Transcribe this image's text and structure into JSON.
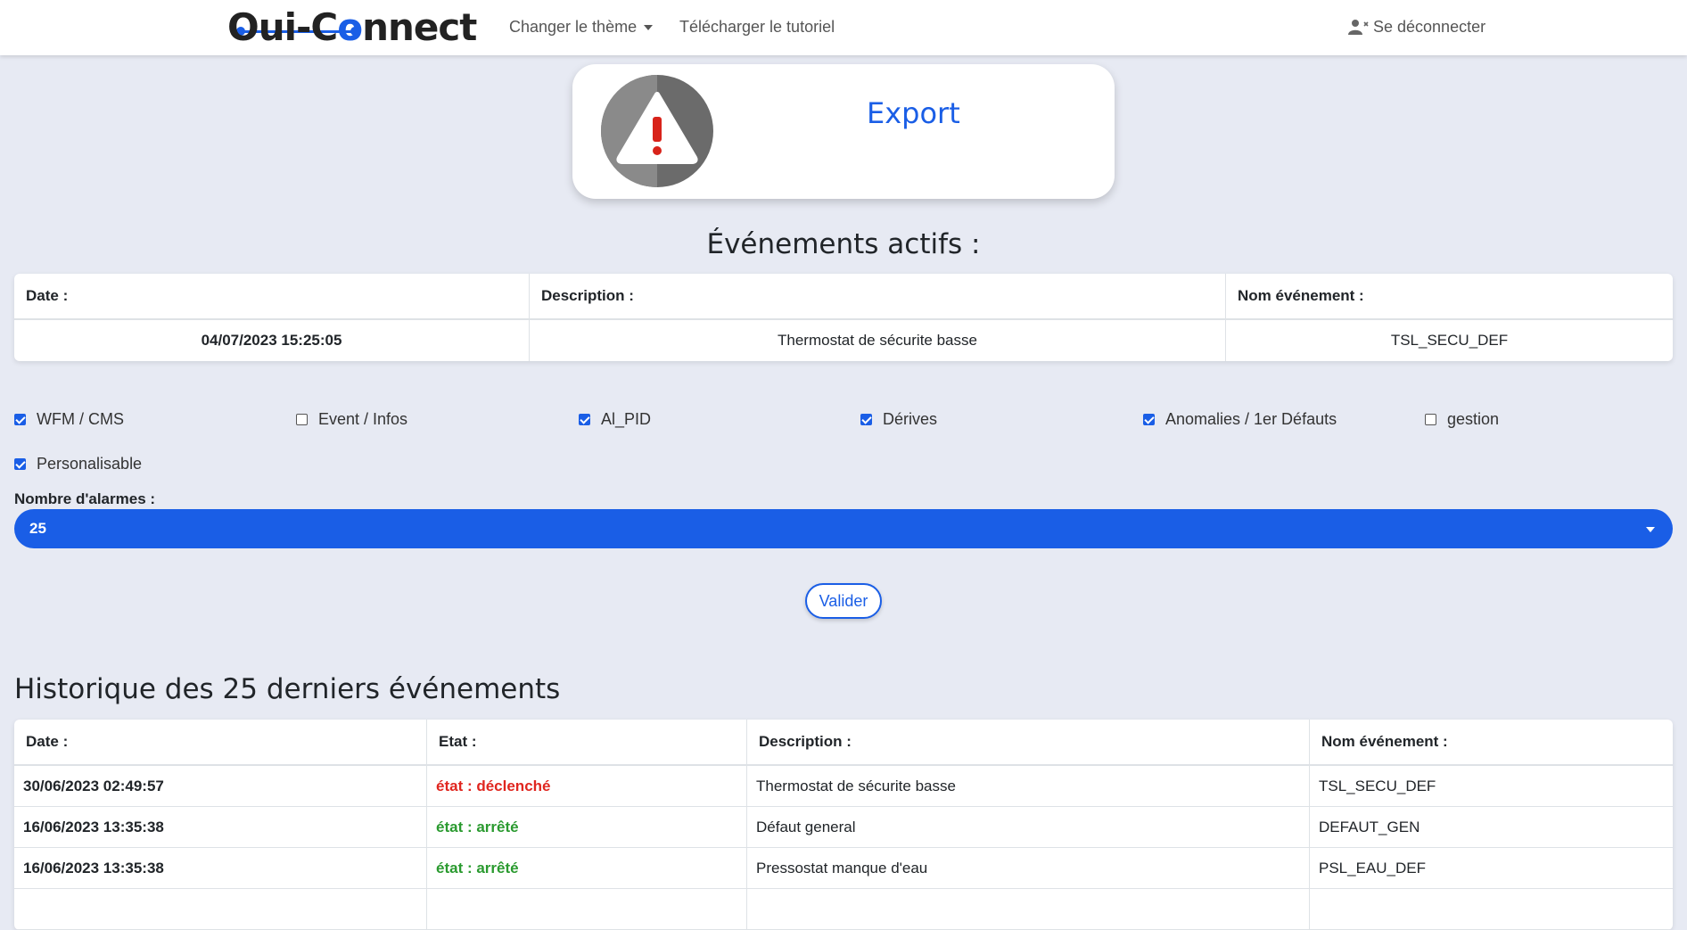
{
  "nav": {
    "logo_part1": "Oui-C",
    "logo_part2": "o",
    "logo_part3": "nnect",
    "theme_label": "Changer le thème",
    "tutorial_label": "Télécharger le tutoriel",
    "logout_label": "Se déconnecter"
  },
  "export": {
    "title": "Export"
  },
  "active_events": {
    "title": "Événements actifs :",
    "headers": [
      "Date :",
      "Description :",
      "Nom événement :"
    ],
    "rows": [
      [
        "04/07/2023 15:25:05",
        "Thermostat de sécurite basse",
        "TSL_SECU_DEF"
      ]
    ]
  },
  "filters": [
    {
      "label": "WFM / CMS",
      "checked": true
    },
    {
      "label": "Event / Infos",
      "checked": false
    },
    {
      "label": "Al_PID",
      "checked": true
    },
    {
      "label": "Dérives",
      "checked": true
    },
    {
      "label": "Anomalies / 1er Défauts",
      "checked": true
    },
    {
      "label": "gestion",
      "checked": false
    },
    {
      "label": "Personalisable",
      "checked": true
    }
  ],
  "alarm_count": {
    "label": "Nombre d'alarmes :",
    "value": "25"
  },
  "validate_label": "Valider",
  "history": {
    "title": "Historique des 25 derniers événements",
    "headers": [
      "Date :",
      "Etat :",
      "Description :",
      "Nom événement :"
    ],
    "rows": [
      [
        "30/06/2023 02:49:57",
        "état : déclenché",
        "Thermostat de sécurite basse",
        "TSL_SECU_DEF"
      ],
      [
        "16/06/2023 13:35:38",
        "état : arrêté",
        "Défaut general",
        "DEFAUT_GEN"
      ],
      [
        "16/06/2023 13:35:38",
        "état : arrêté",
        "Pressostat manque d'eau",
        "PSL_EAU_DEF"
      ],
      [
        "",
        "",
        "",
        ""
      ]
    ]
  },
  "colors": {
    "accent": "#1a5ee6",
    "triggered": "#e0261f",
    "stopped": "#2a9a2f",
    "background": "#e7eaf3"
  }
}
